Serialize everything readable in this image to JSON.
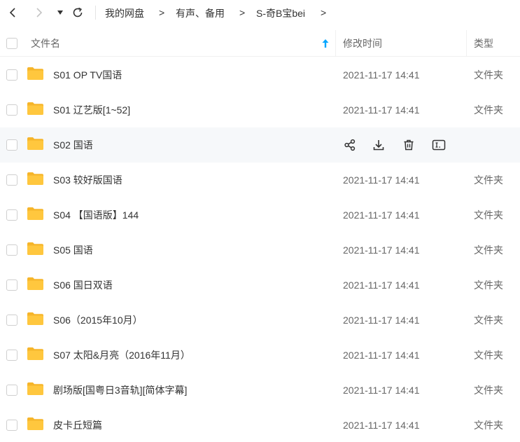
{
  "breadcrumb": {
    "items": [
      "我的网盘",
      "有声、备用",
      "S-奇B宝bei"
    ],
    "separator": ">"
  },
  "header": {
    "name_label": "文件名",
    "time_label": "修改时间",
    "type_label": "类型",
    "sort_icon": "arrow-up-icon"
  },
  "rows": [
    {
      "name": "S01 OP TV国语",
      "time": "2021-11-17 14:41",
      "type": "文件夹"
    },
    {
      "name": "S01 辽艺版[1~52]",
      "time": "2021-11-17 14:41",
      "type": "文件夹"
    },
    {
      "name": "S02 国语",
      "time": "",
      "type": "",
      "hovered": true
    },
    {
      "name": "S03 较好版国语",
      "time": "2021-11-17 14:41",
      "type": "文件夹"
    },
    {
      "name": "S04 【国语版】144",
      "time": "2021-11-17 14:41",
      "type": "文件夹"
    },
    {
      "name": "S05 国语",
      "time": "2021-11-17 14:41",
      "type": "文件夹"
    },
    {
      "name": "S06 国日双语",
      "time": "2021-11-17 14:41",
      "type": "文件夹"
    },
    {
      "name": "S06（2015年10月）",
      "time": "2021-11-17 14:41",
      "type": "文件夹"
    },
    {
      "name": "S07 太阳&月亮（2016年11月）",
      "time": "2021-11-17 14:41",
      "type": "文件夹"
    },
    {
      "name": "剧场版[国粤日3音轨][简体字幕]",
      "time": "2021-11-17 14:41",
      "type": "文件夹"
    },
    {
      "name": "皮卡丘短篇",
      "time": "2021-11-17 14:41",
      "type": "文件夹"
    }
  ],
  "colors": {
    "folder": "#ffc73e",
    "folder_back": "#f6b52a",
    "accent": "#06a7ff",
    "hover_row": "#f6f8fa"
  }
}
